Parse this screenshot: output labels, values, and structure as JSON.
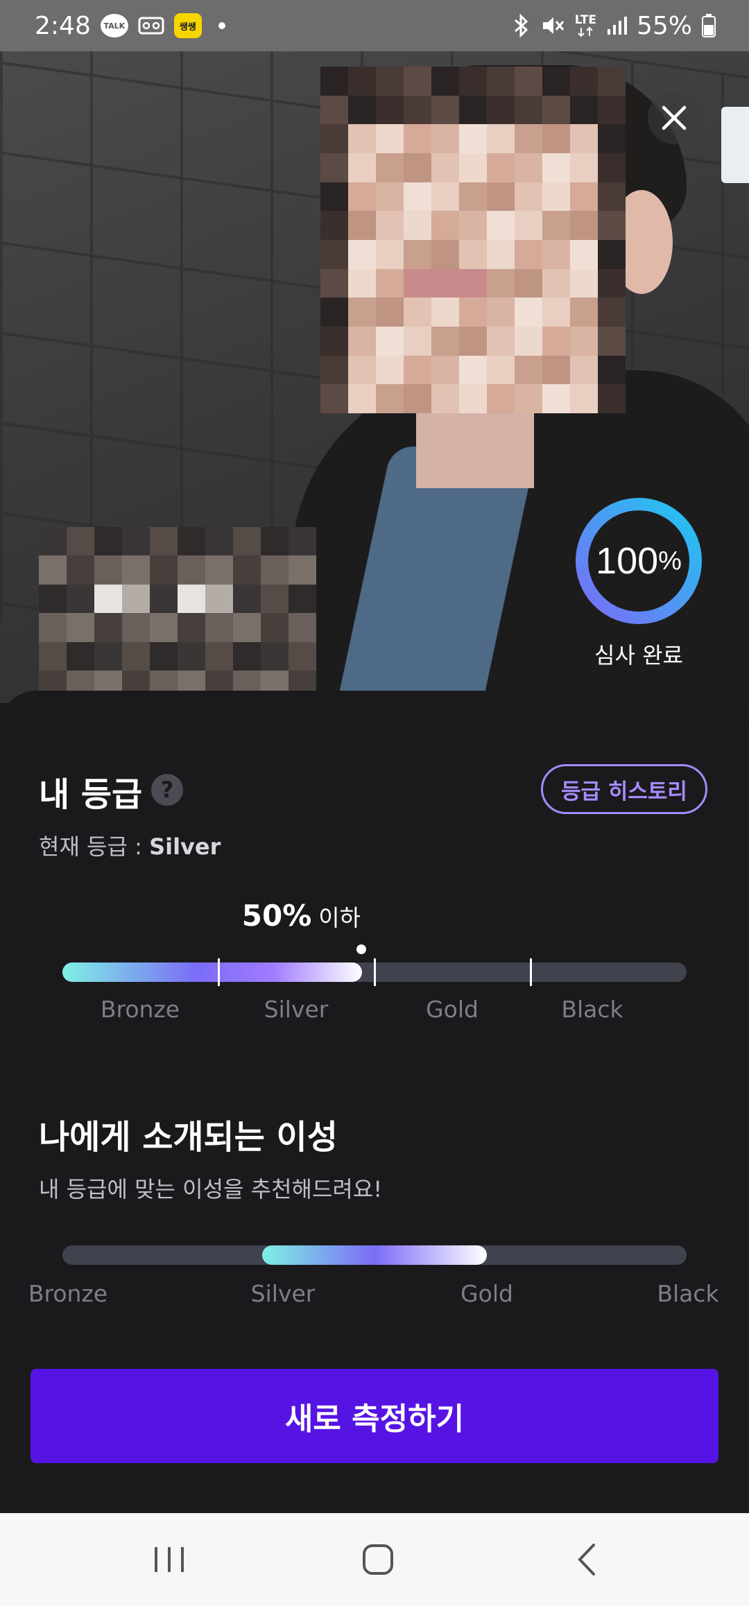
{
  "status_bar": {
    "time": "2:48",
    "notif_icons": [
      "kakaotalk-icon",
      "voicemail-icon",
      "yellow-app-icon",
      "dot-icon"
    ],
    "talk_badge": "TALK",
    "yellow_badge": "쌩쌩",
    "lte_label": "LTE",
    "battery": "55%"
  },
  "profile": {
    "review_progress_percent": 100,
    "review_progress_number": "100",
    "review_progress_unit": "%",
    "review_status": "심사 완료"
  },
  "my_grade": {
    "title": "내 등급",
    "help_label": "?",
    "history_button": "등급 히스토리",
    "current_prefix": "현재 등급 : ",
    "current_value": "Silver",
    "percentile_value": "50%",
    "percentile_suffix": "이하",
    "fill_fraction": 0.48,
    "tiers": [
      "Bronze",
      "Silver",
      "Gold",
      "Black"
    ]
  },
  "matches": {
    "title": "나에게 소개되는 이성",
    "subtitle": "내 등급에 맞는 이성을 추천해드려요!",
    "range_from_fraction": 0.32,
    "range_to_fraction": 0.68,
    "tiers": [
      "Bronze",
      "Silver",
      "Gold",
      "Black"
    ]
  },
  "action": {
    "primary_button": "새로 측정하기"
  },
  "colors": {
    "accent_purple": "#5514e3",
    "history_outline": "#a78bff",
    "ring_start": "#7b6cf6",
    "ring_end": "#1ec8f0"
  }
}
